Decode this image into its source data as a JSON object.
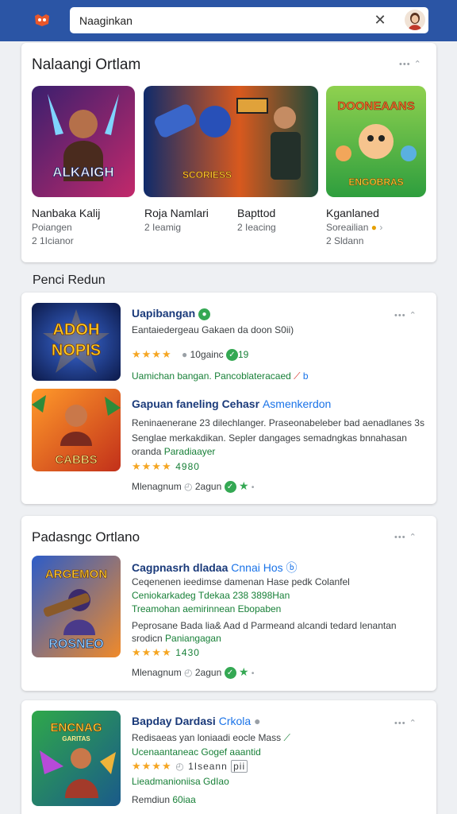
{
  "header": {
    "search_value": "Naaginkan",
    "clear_glyph": "✕",
    "colors": {
      "bar": "#2b55a5"
    }
  },
  "featured": {
    "title": "Nalaangi Ortlam",
    "more_glyph": "••• ⌃",
    "tiles": [
      {
        "name": "Nanbaka Kalij",
        "sub1": "Poiangen",
        "sub2": "2 1Icianor"
      },
      {
        "name": "Roja Namlari",
        "sub1": "2 Ieamig",
        "sub2": ""
      },
      {
        "name": "Bapttod",
        "sub1": "2 Ieacing",
        "sub2": ""
      },
      {
        "name": "Kganlaned",
        "sub1": "Soreailian",
        "sub2": "2 Sldann"
      }
    ],
    "art_text": [
      "ALKAIGH",
      "SCORIESS",
      "DOONEAANS",
      "ENGOBRAS"
    ]
  },
  "section_label": "Penci Redun",
  "list_card_1": {
    "more_glyph": "••• ⌃",
    "items": [
      {
        "art_text": [
          "ADOH",
          "NOPIS"
        ],
        "title": "Uapibangan",
        "title_accent": "",
        "line1": "Eantaiedergeau Gakaen da doon S0ii)",
        "rating": "★★★★",
        "rating_text": "10gainc",
        "badge": "19",
        "green": "Uamichan bangan.  Pancoblateracaed",
        "line2": "",
        "line3": "",
        "foot": ""
      },
      {
        "art_text": [
          "CABBS"
        ],
        "title": "Gapuan faneling Cehasr",
        "title_accent": "Asmenkerdon",
        "line1": "Reninaenerane 23 dilechlanger. Praseonabeleber bad aenadlanes  3s",
        "line2": "Senglae merkakdikan.  Sepler dangages semadngkas bnnahasan",
        "line3": "oranda",
        "green": "Paradiaayer",
        "rating": "★★★★",
        "rating_text": "4980",
        "foot": "Mlenagnum",
        "foot2": "2agun"
      }
    ]
  },
  "list_card_2": {
    "title": "Padasngc Ortlano",
    "more_glyph": "••• ⌃",
    "art_text": [
      "ARGEMON",
      "ROSNEO"
    ],
    "item_title": "Cagpnasrh dladaa",
    "item_accent": "Cnnai Hos",
    "line1": "Ceqenenen ieedimse damenan Hase pedk Colanfel",
    "green1": "Ceniokarkadeg  Tdekaa 238 3898Han",
    "green2": "Treamohan aemirinnean  Ebopaben",
    "line2": "Peprosane Bada lia&  Aad d Parmeand alcandi tedard lenantan",
    "line3": "srodicn",
    "green3": "Paniangagan",
    "rating": "★★★★",
    "rating_text": "1430",
    "foot": "Mlenagnum",
    "foot2": "2agun"
  },
  "list_card_3": {
    "more_glyph": "••• ⌃",
    "art_text": [
      "ENCNAG",
      "GARITAS"
    ],
    "item_title": "Bapday Dardasi",
    "item_accent": "Crkola",
    "line1": "Redisaeas yan loniaadi eocle Mass",
    "green1": "Ucenaantaneac Gogef aaantid",
    "rating": "★★★★",
    "rating_text": "1Iseann",
    "badge": "pii",
    "green2": "Lieadmanioniisa  GdIao",
    "foot": "Remdiun",
    "foot_green": "60iaa"
  }
}
